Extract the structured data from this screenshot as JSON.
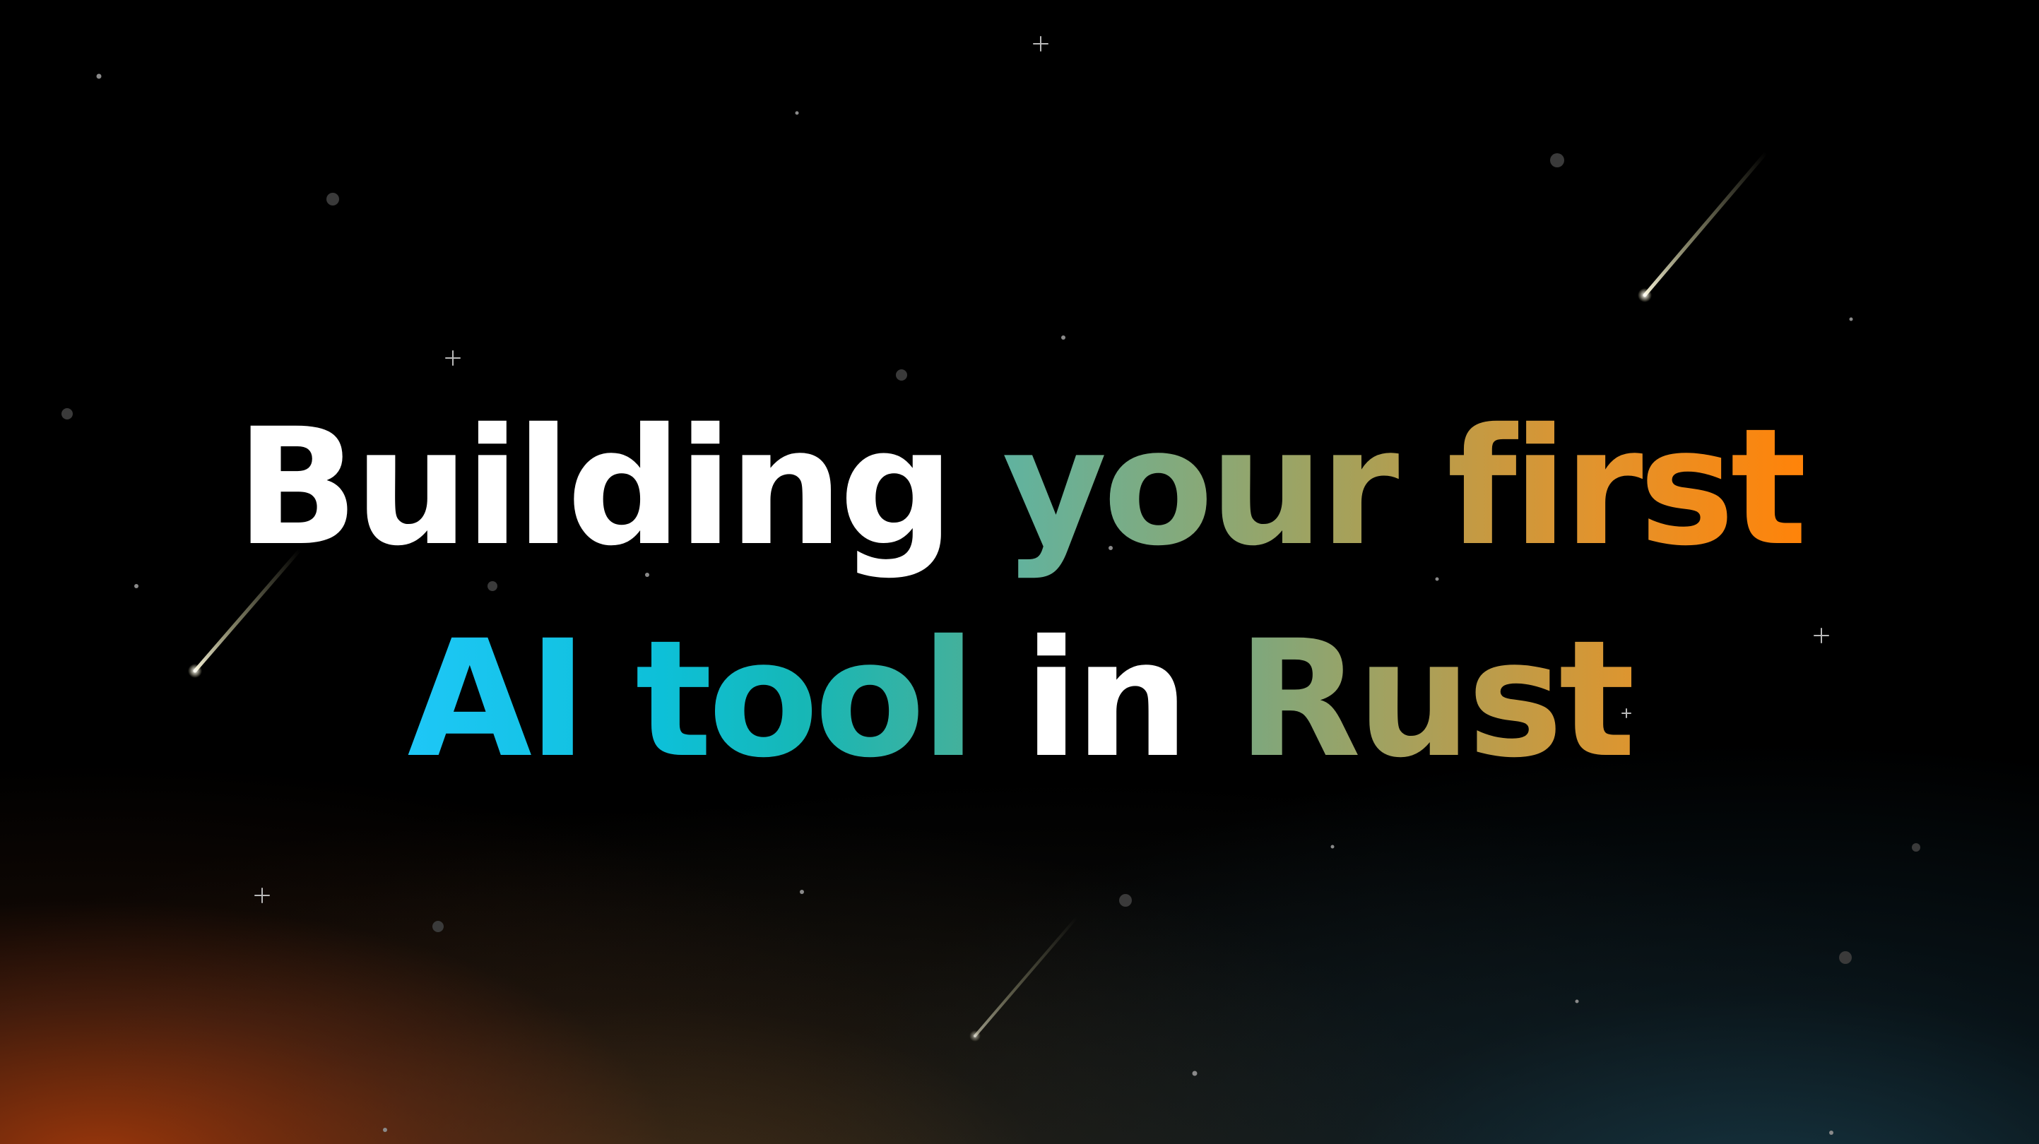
{
  "headline": {
    "line1": {
      "part1": "Building",
      "part2": "your first"
    },
    "line2": {
      "part1": "AI tool",
      "part2": "in",
      "part3": "Rust"
    }
  },
  "colors": {
    "background": "#000000",
    "text_white": "#ffffff",
    "accent_orange": "#ff8309",
    "accent_cyan": "#1ec7f7",
    "accent_teal": "#16b7b6",
    "glow_bottom_left": "#a53a0c",
    "glow_bottom_right": "#183a48"
  },
  "decorations": {
    "background_icon": "starfield-icon",
    "meteor_icon": "shooting-star-icon",
    "sparkle_icon": "sparkle-icon"
  }
}
